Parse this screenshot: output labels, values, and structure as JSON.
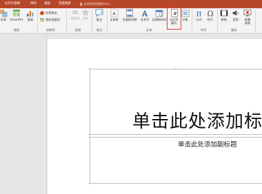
{
  "tabs": [
    "幻灯片放映",
    "审阅",
    "视图",
    "百度网盘"
  ],
  "tell_me": "告诉我您想要做什么...",
  "ribbon": {
    "groups": {
      "illustrations": "插图",
      "addins": "加载项",
      "links": "链接",
      "comments": "批注",
      "text": "文本",
      "symbols": "符号",
      "media": "媒体"
    },
    "buttons": {
      "shapes": "形状",
      "smartart": "SmartArt",
      "chart": "图表",
      "store": "应用商店",
      "my_addins": "我的加载项",
      "links": "超链接",
      "action": "动作",
      "comment": "批注",
      "textbox": "文本框",
      "header_footer": "页眉和页脚",
      "wordart": "艺术字",
      "date_time": "日期和时间",
      "slide_number_1": "幻灯片",
      "slide_number_2": "编号",
      "object": "对象",
      "equation": "公式",
      "symbol": "符号",
      "video": "视频",
      "audio": "音频",
      "screen_recording_1": "屏幕",
      "screen_recording_2": "录制"
    }
  },
  "slide": {
    "title_placeholder": "单击此处添加标",
    "subtitle_placeholder": "单击此处添加副标题"
  },
  "colors": {
    "accent": "#b7472a",
    "highlight": "#e53935"
  }
}
